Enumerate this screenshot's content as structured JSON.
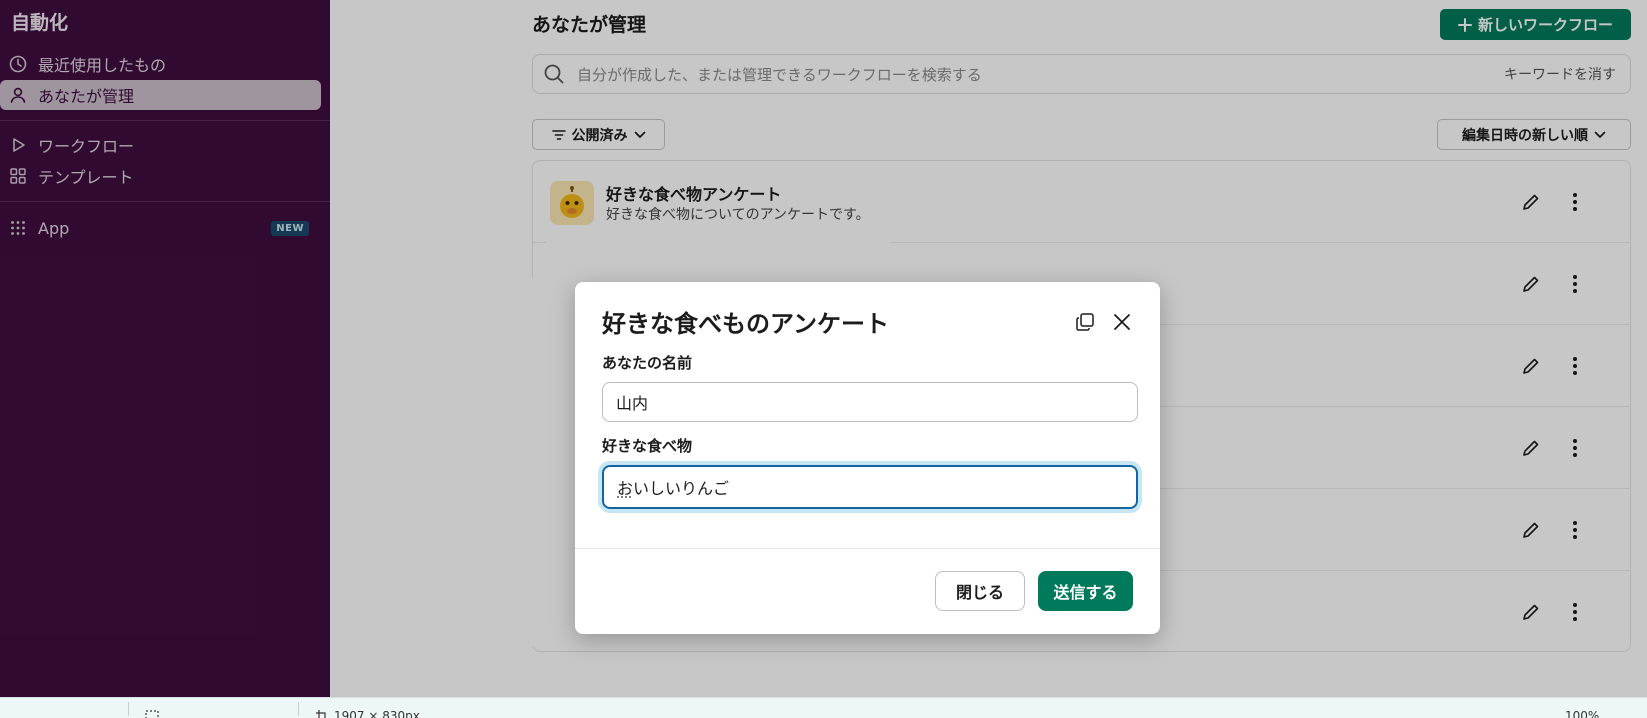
{
  "sidebar": {
    "title": "自動化",
    "items": [
      {
        "label": "最近使用したもの",
        "icon": "clock-icon"
      },
      {
        "label": "あなたが管理",
        "icon": "user-icon",
        "active": true
      },
      {
        "label": "ワークフロー",
        "icon": "play-icon"
      },
      {
        "label": "テンプレート",
        "icon": "grid-icon"
      },
      {
        "label": "App",
        "icon": "apps-icon",
        "badge": "NEW"
      }
    ]
  },
  "main": {
    "title": "あなたが管理",
    "new_workflow_label": "新しいワークフロー",
    "search": {
      "placeholder": "自分が作成した、または管理できるワークフローを検索する",
      "clear_label": "キーワードを消す"
    },
    "filter_label": "公開済み",
    "sort_label": "編集日時の新しい順",
    "workflows": [
      {
        "name": "好きな食べ物アンケート",
        "description": "好きな食べ物についてのアンケートです。"
      }
    ]
  },
  "modal": {
    "title": "好きな食べものアンケート",
    "fields": [
      {
        "label": "あなたの名前",
        "value": "山内"
      },
      {
        "label": "好きな食べ物",
        "value_ime": "お",
        "value_rest": "いしいりんご"
      }
    ],
    "close_label": "閉じる",
    "submit_label": "送信する"
  },
  "statusbar": {
    "dimensions": "1907 × 830px",
    "zoom": "100%"
  },
  "colors": {
    "sidebar_bg": "#3f0e40",
    "accent_green": "#007a5a",
    "focus_blue": "#1264a3"
  }
}
